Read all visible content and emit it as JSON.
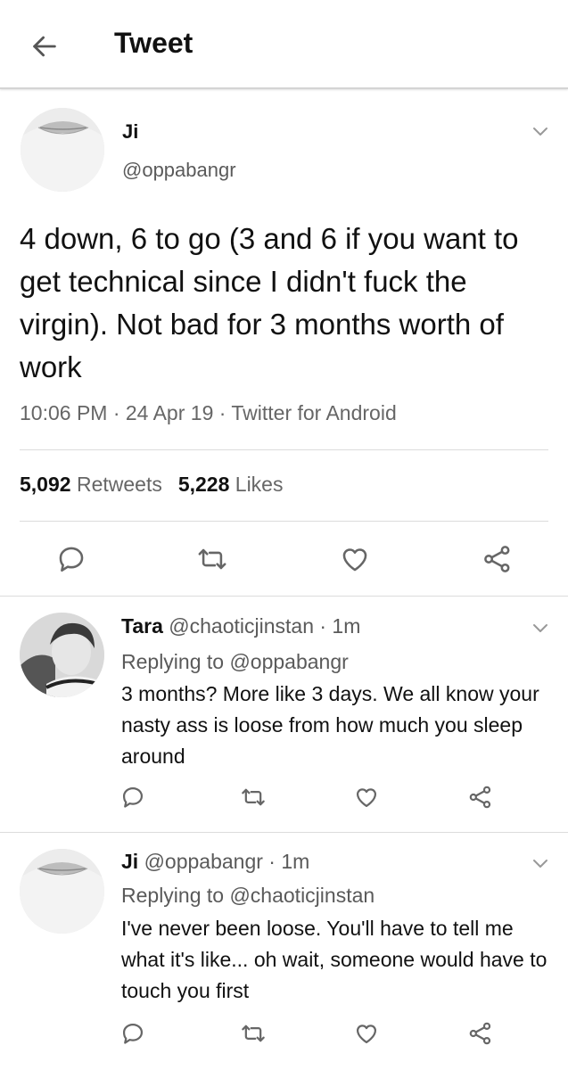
{
  "header": {
    "title": "Tweet",
    "back_icon": "arrow-left-icon"
  },
  "main_tweet": {
    "name": "Ji",
    "handle": "@oppabangr",
    "text": "4 down, 6 to go (3 and 6 if you want to get technical since I didn't fuck the virgin). Not bad for 3 months worth of work",
    "time": "10:06 PM · 24 Apr 19 · Twitter for Android",
    "retweets_count": "5,092",
    "retweets_label": "Retweets",
    "likes_count": "5,228",
    "likes_label": "Likes"
  },
  "replies": [
    {
      "name": "Tara",
      "handle_time": "@chaoticjinstan · 1m",
      "replying_to": "Replying to @oppabangr",
      "text": "3 months? More like 3 days. We all know your nasty ass is loose from how much you sleep around"
    },
    {
      "name": "Ji",
      "handle_time": "@oppabangr · 1m",
      "replying_to": "Replying to @chaoticjinstan",
      "text": "I've never been loose. You'll have to tell me what it's like... oh wait, someone would have to touch you first"
    }
  ],
  "icons": [
    "arrow-left-icon",
    "chevron-down-icon",
    "reply-icon",
    "retweet-icon",
    "like-icon",
    "share-icon"
  ],
  "colors": {
    "text": "#111111",
    "secondary": "#5a5a5a",
    "icon": "#666666",
    "divider": "#dcdcdc"
  }
}
